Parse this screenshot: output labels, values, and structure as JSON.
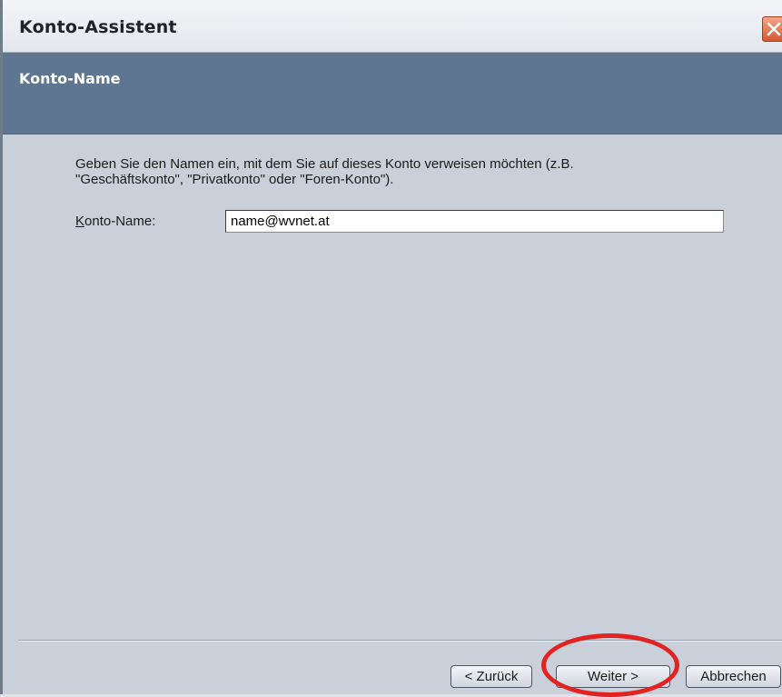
{
  "window": {
    "title": "Konto-Assistent",
    "close_icon": "close-icon"
  },
  "header": {
    "heading": "Konto-Name"
  },
  "main": {
    "description_line1": "Geben Sie den Namen ein, mit dem Sie auf dieses Konto verweisen möchten (z.B.",
    "description_line2": "\"Geschäftskonto\", \"Privatkonto\" oder \"Foren-Konto\").",
    "label_accel": "K",
    "label_rest": "onto-Name:",
    "input_value": "name@wvnet.at"
  },
  "buttons": {
    "back": "< Zurück",
    "next": "Weiter >",
    "cancel": "Abbrechen"
  },
  "colors": {
    "header_band": "#5f7690",
    "body": "#c9d0da",
    "highlight": "#e32222",
    "close_button": "#d35a33"
  }
}
